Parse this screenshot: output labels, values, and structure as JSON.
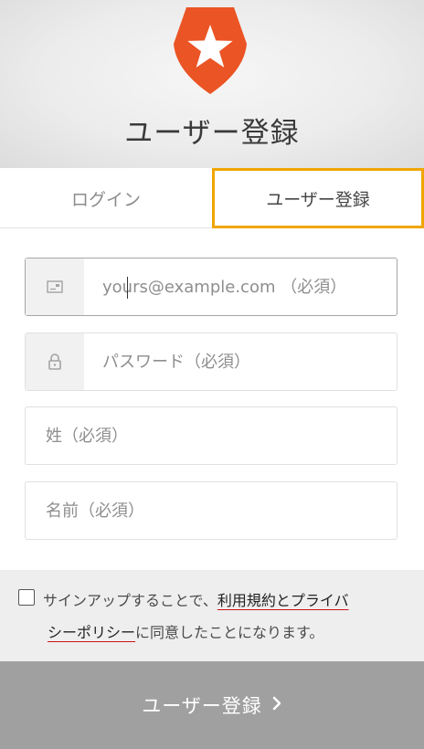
{
  "header": {
    "title": "ユーザー登録",
    "logo_icon": "auth0-star-shield-logo",
    "brand_color": "#eb5424"
  },
  "tabs": [
    {
      "label": "ログイン",
      "selected": false
    },
    {
      "label": "ユーザー登録",
      "selected": true
    }
  ],
  "form": {
    "email": {
      "icon": "envelope-icon",
      "placeholder": "yours@example.com （必須）",
      "value": ""
    },
    "password": {
      "icon": "lock-icon",
      "placeholder": "パスワード（必須）",
      "value": ""
    },
    "last_name": {
      "placeholder": "姓（必須）",
      "value": ""
    },
    "first_name": {
      "placeholder": "名前（必須）",
      "value": ""
    }
  },
  "terms": {
    "checked": false,
    "prefix": "サインアップすることで、",
    "link1": "利用規約とプライバ",
    "link2": "シーポリシー",
    "suffix": "に同意したことになります。"
  },
  "submit": {
    "label": "ユーザー登録",
    "icon": "chevron-right-icon"
  },
  "colors": {
    "highlight": "#f0a500",
    "link_underline": "#d0121b",
    "submit_bg": "#a0a0a0"
  }
}
